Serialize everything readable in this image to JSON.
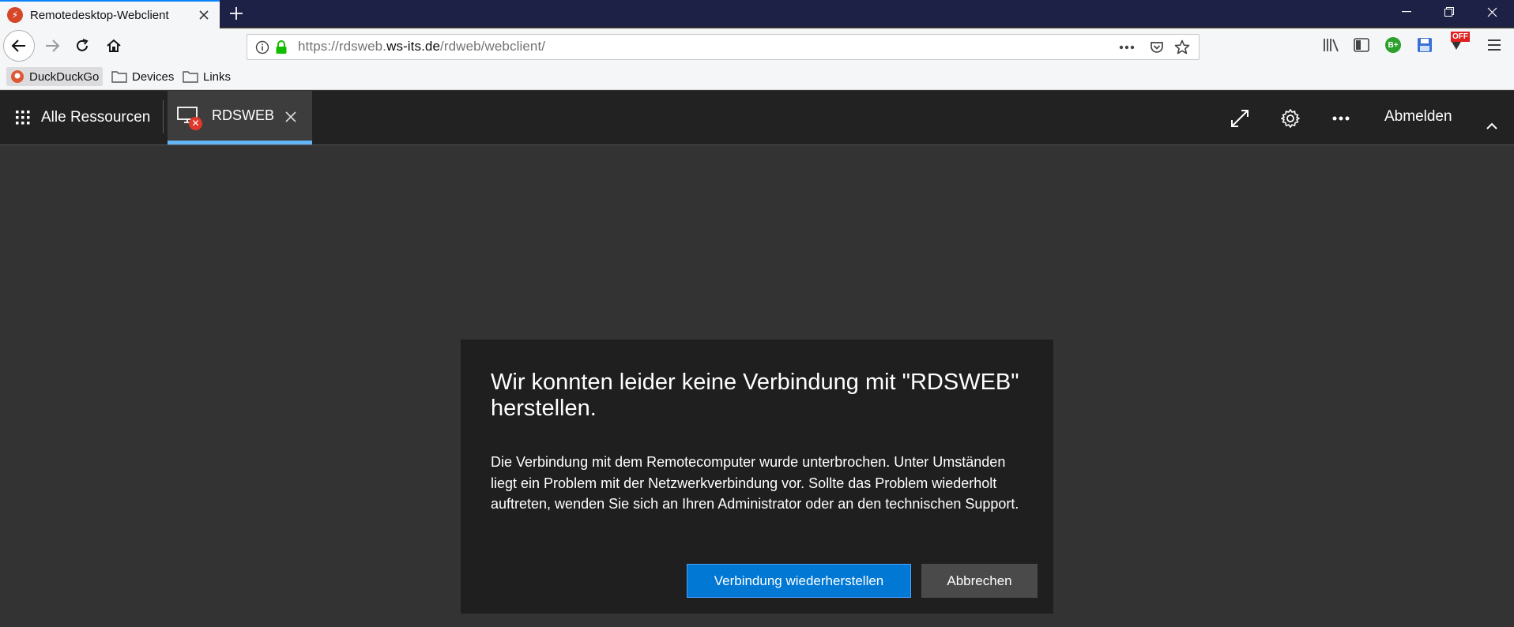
{
  "browser": {
    "tab": {
      "title": "Remotedesktop-Webclient"
    },
    "url": {
      "scheme": "https://",
      "subdomain": "rdsweb.",
      "host": "ws-its.de",
      "path": "/rdweb/webclient/"
    },
    "bookmarks": [
      {
        "label": "DuckDuckGo"
      },
      {
        "label": "Devices"
      },
      {
        "label": "Links"
      }
    ],
    "extensions": {
      "badge_off": "OFF",
      "badge_b": "B+"
    }
  },
  "app": {
    "all_resources": "Alle Ressourcen",
    "session_tab": "RDSWEB",
    "signout": "Abmelden"
  },
  "dialog": {
    "title": "Wir konnten leider keine Verbindung mit \"RDSWEB\" herstellen.",
    "body": "Die Verbindung mit dem Remotecomputer wurde unterbrochen. Unter Umständen liegt ein Problem mit der Netzwerkverbindung vor. Sollte das Problem wiederholt auftreten, wenden Sie sich an Ihren Administrator oder an den technischen Support.",
    "reconnect": "Verbindung wiederherstellen",
    "cancel": "Abbrechen"
  },
  "colors": {
    "primary": "#0078d4",
    "tab_accent": "#64b5f6",
    "error": "#e0392b",
    "titlebar": "#1c2145"
  }
}
